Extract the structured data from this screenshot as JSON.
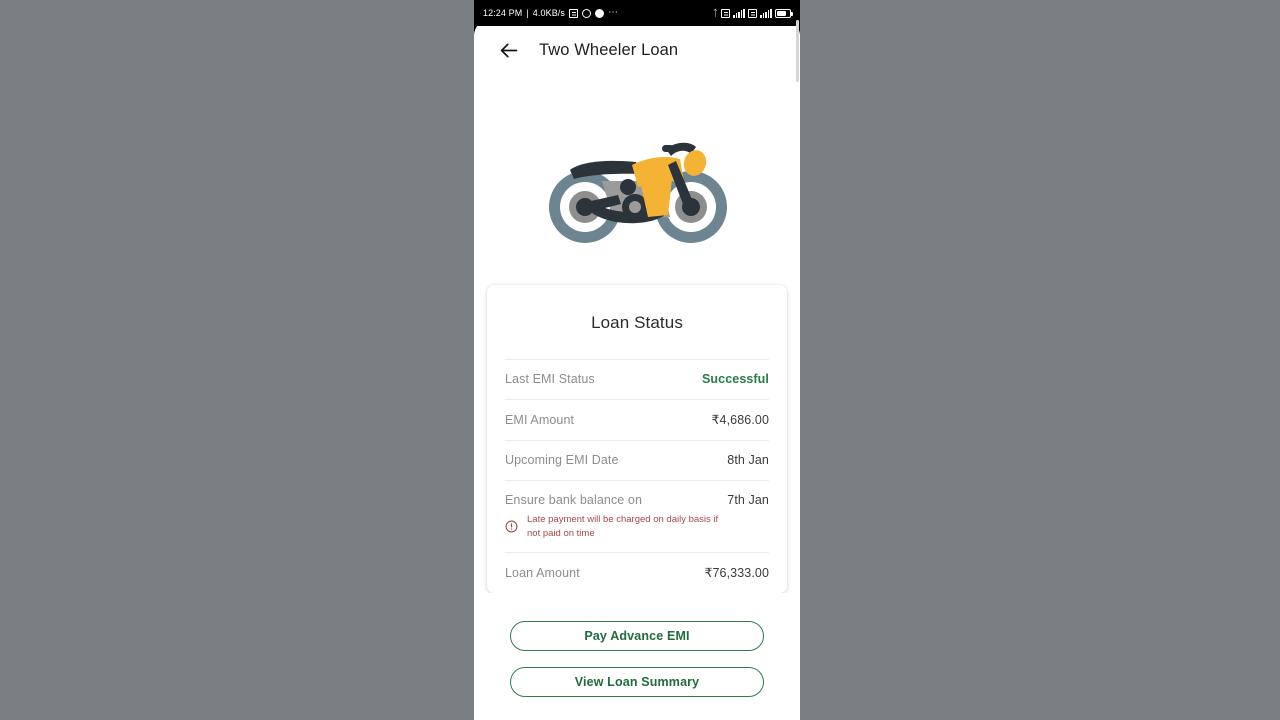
{
  "status_bar": {
    "time": "12:24 PM",
    "separator": "|",
    "network_speed": "4.0KB/s",
    "left_icons": [
      "sim-card-icon",
      "whatsapp-icon",
      "chat-bubble-icon",
      "more-dots-icon"
    ],
    "right_icons": [
      "bluetooth-icon",
      "sim1-signal-icon",
      "signal-bars-icon",
      "sim2-signal-icon",
      "signal-bars-2-icon",
      "battery-icon"
    ],
    "battery_level": "69"
  },
  "app_bar": {
    "back_icon": "arrow-left-icon",
    "title": "Two Wheeler Loan"
  },
  "hero": {
    "illustration": "motorcycle-illustration",
    "colors": {
      "body_dark": "#2b333b",
      "tank_yellow": "#f5b335",
      "engine_gray": "#9b9b9b",
      "wheel_rim": "#6d8590",
      "wheel_hub": "#8e8e8e"
    }
  },
  "loan_card": {
    "title": "Loan Status",
    "rows": [
      {
        "label": "Last EMI Status",
        "value": "Successful",
        "style": "success"
      },
      {
        "label": "EMI Amount",
        "value": "₹4,686.00",
        "style": "normal"
      },
      {
        "label": "Upcoming EMI Date",
        "value": "8th Jan",
        "style": "normal"
      },
      {
        "label": "Ensure bank balance on",
        "value": "7th Jan",
        "style": "normal"
      },
      {
        "label": "Loan Amount",
        "value": "₹76,333.00",
        "style": "normal"
      }
    ],
    "late_note": {
      "icon": "info-circle-icon",
      "text": "Late payment will be charged on daily basis if not paid on time"
    }
  },
  "actions": {
    "pay_advance_emi": "Pay Advance EMI",
    "view_loan_summary": "View Loan Summary"
  },
  "colors": {
    "background": "#797f83",
    "success_green": "#267d45",
    "button_green": "#2e7d4f",
    "warning_red": "#a4494b",
    "label_gray": "#8d8d8d"
  }
}
